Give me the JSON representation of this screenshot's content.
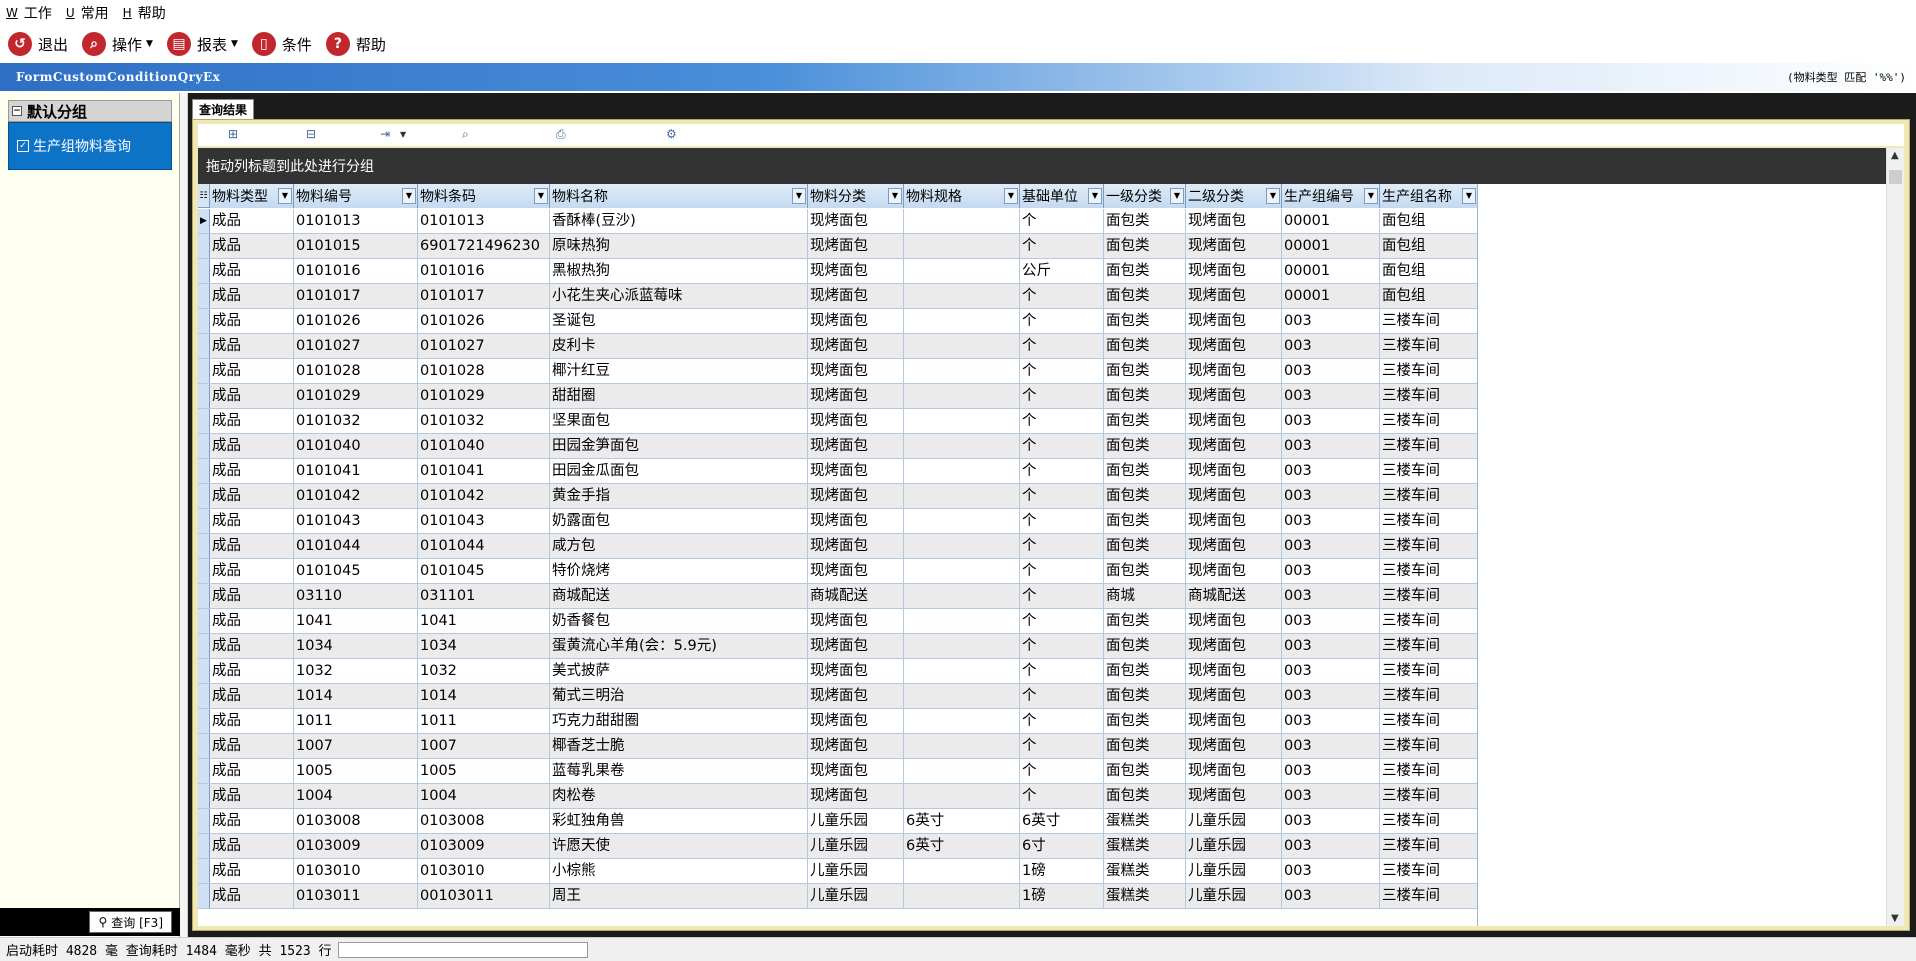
{
  "menubar": {
    "items": [
      {
        "accel": "W",
        "label": "工作"
      },
      {
        "accel": "U",
        "label": "常用"
      },
      {
        "accel": "H",
        "label": "帮助"
      }
    ]
  },
  "toolbar": {
    "exit_label": "退出",
    "operate_label": "操作",
    "report_label": "报表",
    "condition_label": "条件",
    "help_label": "帮助"
  },
  "window": {
    "title": "FormCustomConditionQryEx",
    "condition_text": "(物料类型 匹配 '%%')"
  },
  "left_panel": {
    "group_title": "默认分组",
    "item_label": "生产组物料查询",
    "query_button": "查询 [F3]"
  },
  "tab": {
    "label": "查询结果"
  },
  "grid": {
    "group_hint": "拖动列标题到此处进行分组",
    "columns": [
      "物料类型",
      "物料编号",
      "物料条码",
      "物料名称",
      "物料分类",
      "物料规格",
      "基础单位",
      "一级分类",
      "二级分类",
      "生产组编号",
      "生产组名称"
    ],
    "rows": [
      [
        "成品",
        "0101013",
        "0101013",
        "香酥棒(豆沙)",
        "现烤面包",
        "",
        "个",
        "面包类",
        "现烤面包",
        "00001",
        "面包组"
      ],
      [
        "成品",
        "0101015",
        "6901721496230",
        "原味热狗",
        "现烤面包",
        "",
        "个",
        "面包类",
        "现烤面包",
        "00001",
        "面包组"
      ],
      [
        "成品",
        "0101016",
        "0101016",
        "黑椒热狗",
        "现烤面包",
        "",
        "公斤",
        "面包类",
        "现烤面包",
        "00001",
        "面包组"
      ],
      [
        "成品",
        "0101017",
        "0101017",
        "小花生夹心派蓝莓味",
        "现烤面包",
        "",
        "个",
        "面包类",
        "现烤面包",
        "00001",
        "面包组"
      ],
      [
        "成品",
        "0101026",
        "0101026",
        "圣诞包",
        "现烤面包",
        "",
        "个",
        "面包类",
        "现烤面包",
        "003",
        "三楼车间"
      ],
      [
        "成品",
        "0101027",
        "0101027",
        "皮利卡",
        "现烤面包",
        "",
        "个",
        "面包类",
        "现烤面包",
        "003",
        "三楼车间"
      ],
      [
        "成品",
        "0101028",
        "0101028",
        "椰汁红豆",
        "现烤面包",
        "",
        "个",
        "面包类",
        "现烤面包",
        "003",
        "三楼车间"
      ],
      [
        "成品",
        "0101029",
        "0101029",
        "甜甜圈",
        "现烤面包",
        "",
        "个",
        "面包类",
        "现烤面包",
        "003",
        "三楼车间"
      ],
      [
        "成品",
        "0101032",
        "0101032",
        "坚果面包",
        "现烤面包",
        "",
        "个",
        "面包类",
        "现烤面包",
        "003",
        "三楼车间"
      ],
      [
        "成品",
        "0101040",
        "0101040",
        "田园金笋面包",
        "现烤面包",
        "",
        "个",
        "面包类",
        "现烤面包",
        "003",
        "三楼车间"
      ],
      [
        "成品",
        "0101041",
        "0101041",
        "田园金瓜面包",
        "现烤面包",
        "",
        "个",
        "面包类",
        "现烤面包",
        "003",
        "三楼车间"
      ],
      [
        "成品",
        "0101042",
        "0101042",
        "黄金手指",
        "现烤面包",
        "",
        "个",
        "面包类",
        "现烤面包",
        "003",
        "三楼车间"
      ],
      [
        "成品",
        "0101043",
        "0101043",
        "奶露面包",
        "现烤面包",
        "",
        "个",
        "面包类",
        "现烤面包",
        "003",
        "三楼车间"
      ],
      [
        "成品",
        "0101044",
        "0101044",
        "咸方包",
        "现烤面包",
        "",
        "个",
        "面包类",
        "现烤面包",
        "003",
        "三楼车间"
      ],
      [
        "成品",
        "0101045",
        "0101045",
        "特价烧烤",
        "现烤面包",
        "",
        "个",
        "面包类",
        "现烤面包",
        "003",
        "三楼车间"
      ],
      [
        "成品",
        "03110",
        "031101",
        "商城配送",
        "商城配送",
        "",
        "个",
        "商城",
        "商城配送",
        "003",
        "三楼车间"
      ],
      [
        "成品",
        "1041",
        "1041",
        "奶香餐包",
        "现烤面包",
        "",
        "个",
        "面包类",
        "现烤面包",
        "003",
        "三楼车间"
      ],
      [
        "成品",
        "1034",
        "1034",
        "蛋黄流心羊角(会：5.9元)",
        "现烤面包",
        "",
        "个",
        "面包类",
        "现烤面包",
        "003",
        "三楼车间"
      ],
      [
        "成品",
        "1032",
        "1032",
        "美式披萨",
        "现烤面包",
        "",
        "个",
        "面包类",
        "现烤面包",
        "003",
        "三楼车间"
      ],
      [
        "成品",
        "1014",
        "1014",
        "葡式三明治",
        "现烤面包",
        "",
        "个",
        "面包类",
        "现烤面包",
        "003",
        "三楼车间"
      ],
      [
        "成品",
        "1011",
        "1011",
        "巧克力甜甜圈",
        "现烤面包",
        "",
        "个",
        "面包类",
        "现烤面包",
        "003",
        "三楼车间"
      ],
      [
        "成品",
        "1007",
        "1007",
        "椰香芝士脆",
        "现烤面包",
        "",
        "个",
        "面包类",
        "现烤面包",
        "003",
        "三楼车间"
      ],
      [
        "成品",
        "1005",
        "1005",
        "蓝莓乳果卷",
        "现烤面包",
        "",
        "个",
        "面包类",
        "现烤面包",
        "003",
        "三楼车间"
      ],
      [
        "成品",
        "1004",
        "1004",
        "肉松卷",
        "现烤面包",
        "",
        "个",
        "面包类",
        "现烤面包",
        "003",
        "三楼车间"
      ],
      [
        "成品",
        "0103008",
        "0103008",
        "彩虹独角兽",
        "儿童乐园",
        "6英寸",
        "6英寸",
        "蛋糕类",
        "儿童乐园",
        "003",
        "三楼车间"
      ],
      [
        "成品",
        "0103009",
        "0103009",
        "许愿天使",
        "儿童乐园",
        "6英寸",
        "6寸",
        "蛋糕类",
        "儿童乐园",
        "003",
        "三楼车间"
      ],
      [
        "成品",
        "0103010",
        "0103010",
        "小棕熊",
        "儿童乐园",
        "",
        "1磅",
        "蛋糕类",
        "儿童乐园",
        "003",
        "三楼车间"
      ],
      [
        "成品",
        "0103011",
        "00103011",
        "周王",
        "儿童乐园",
        "",
        "1磅",
        "蛋糕类",
        "儿童乐园",
        "003",
        "三楼车间"
      ]
    ]
  },
  "status": {
    "text": "启动耗时 4828 毫 查询耗时 1484 毫秒  共 1523 行"
  }
}
